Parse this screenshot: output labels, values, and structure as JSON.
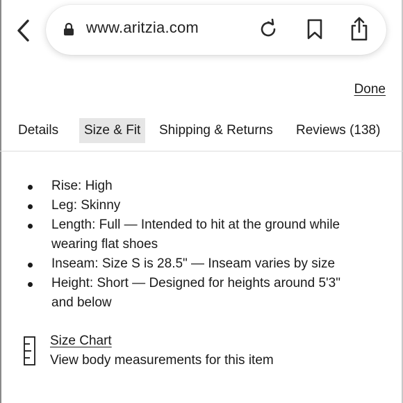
{
  "browser": {
    "url": "www.aritzia.com",
    "icons": {
      "back": "chevron-left-icon",
      "lock": "lock-icon",
      "reload": "reload-icon",
      "bookmark": "bookmark-icon",
      "share": "share-icon"
    }
  },
  "header": {
    "done_label": "Done"
  },
  "tabs": [
    {
      "label": "Details",
      "active": false
    },
    {
      "label": "Size & Fit",
      "active": true
    },
    {
      "label": "Shipping & Returns",
      "active": false
    },
    {
      "label": "Reviews (138)",
      "active": false
    }
  ],
  "specs": [
    {
      "line1": "Rise: High",
      "line2": ""
    },
    {
      "line1": "Leg: Skinny",
      "line2": ""
    },
    {
      "line1": "Length: Full — Intended to hit at the ground while",
      "line2": "wearing flat shoes"
    },
    {
      "line1": "Inseam: Size S is 28.5\" — Inseam varies by size",
      "line2": ""
    },
    {
      "line1": "Height: Short — Designed for heights around 5'3\"",
      "line2": "and below"
    }
  ],
  "size_chart": {
    "link_label": "Size Chart",
    "description": "View body measurements for this item",
    "icon": "ruler-icon"
  }
}
